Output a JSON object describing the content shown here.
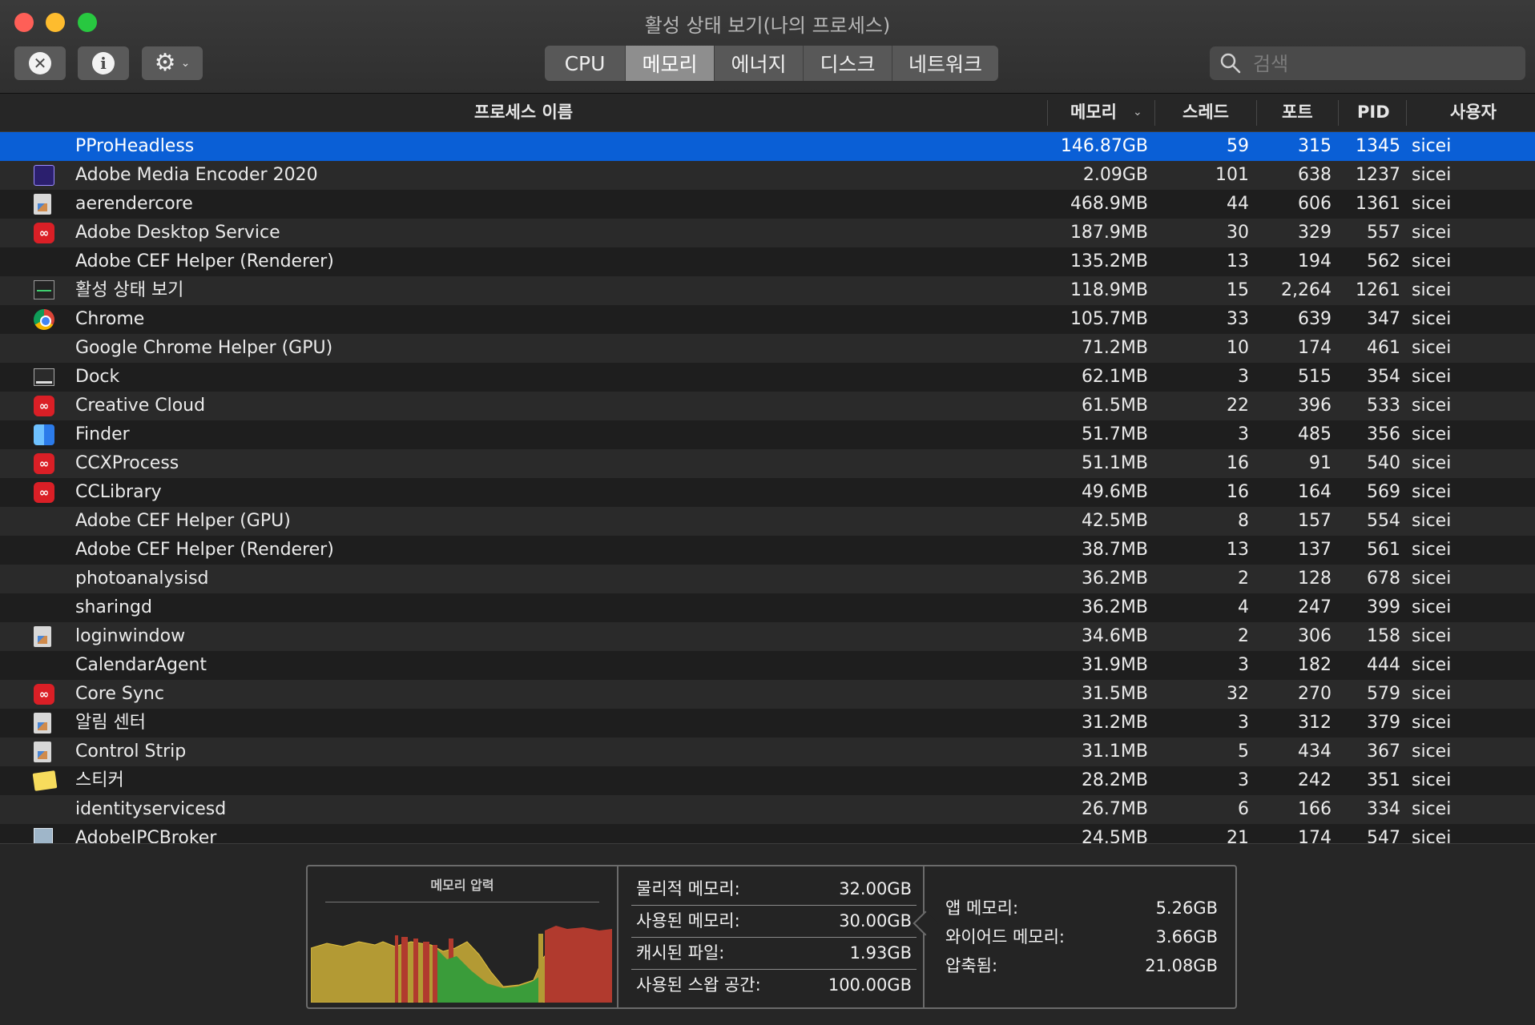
{
  "window": {
    "title": "활성 상태 보기(나의 프로세스)"
  },
  "toolbar": {
    "stop_icon": "x-circle-icon",
    "info_icon": "info-circle-icon",
    "gear_icon": "gear-icon",
    "tabs": [
      "CPU",
      "메모리",
      "에너지",
      "디스크",
      "네트워크"
    ],
    "active_tab": "메모리",
    "search": {
      "placeholder": "검색",
      "value": ""
    }
  },
  "table": {
    "columns": {
      "name": "프로세스 이름",
      "memory": "메모리",
      "threads": "스레드",
      "ports": "포트",
      "pid": "PID",
      "user": "사용자"
    },
    "sort_column": "memory",
    "sort_direction": "descending",
    "rows": [
      {
        "name": "PProHeadless",
        "memory": "146.87GB",
        "threads": "59",
        "ports": "315",
        "pid": "1345",
        "user": "sicei",
        "icon": "none",
        "selected": true
      },
      {
        "name": "Adobe Media Encoder 2020",
        "memory": "2.09GB",
        "threads": "101",
        "ports": "638",
        "pid": "1237",
        "user": "sicei",
        "icon": "media-encoder-icon"
      },
      {
        "name": "aerendercore",
        "memory": "468.9MB",
        "threads": "44",
        "ports": "606",
        "pid": "1361",
        "user": "sicei",
        "icon": "generic-app-icon"
      },
      {
        "name": "Adobe Desktop Service",
        "memory": "187.9MB",
        "threads": "30",
        "ports": "329",
        "pid": "557",
        "user": "sicei",
        "icon": "creative-cloud-icon"
      },
      {
        "name": "Adobe CEF Helper (Renderer)",
        "memory": "135.2MB",
        "threads": "13",
        "ports": "194",
        "pid": "562",
        "user": "sicei",
        "icon": "none"
      },
      {
        "name": "활성 상태 보기",
        "memory": "118.9MB",
        "threads": "15",
        "ports": "2,264",
        "pid": "1261",
        "user": "sicei",
        "icon": "activity-monitor-icon"
      },
      {
        "name": "Chrome",
        "memory": "105.7MB",
        "threads": "33",
        "ports": "639",
        "pid": "347",
        "user": "sicei",
        "icon": "chrome-icon"
      },
      {
        "name": "Google Chrome Helper (GPU)",
        "memory": "71.2MB",
        "threads": "10",
        "ports": "174",
        "pid": "461",
        "user": "sicei",
        "icon": "none"
      },
      {
        "name": "Dock",
        "memory": "62.1MB",
        "threads": "3",
        "ports": "515",
        "pid": "354",
        "user": "sicei",
        "icon": "dock-icon"
      },
      {
        "name": "Creative Cloud",
        "memory": "61.5MB",
        "threads": "22",
        "ports": "396",
        "pid": "533",
        "user": "sicei",
        "icon": "creative-cloud-icon"
      },
      {
        "name": "Finder",
        "memory": "51.7MB",
        "threads": "3",
        "ports": "485",
        "pid": "356",
        "user": "sicei",
        "icon": "finder-icon"
      },
      {
        "name": "CCXProcess",
        "memory": "51.1MB",
        "threads": "16",
        "ports": "91",
        "pid": "540",
        "user": "sicei",
        "icon": "creative-cloud-icon"
      },
      {
        "name": "CCLibrary",
        "memory": "49.6MB",
        "threads": "16",
        "ports": "164",
        "pid": "569",
        "user": "sicei",
        "icon": "creative-cloud-icon"
      },
      {
        "name": "Adobe CEF Helper (GPU)",
        "memory": "42.5MB",
        "threads": "8",
        "ports": "157",
        "pid": "554",
        "user": "sicei",
        "icon": "none"
      },
      {
        "name": "Adobe CEF Helper (Renderer)",
        "memory": "38.7MB",
        "threads": "13",
        "ports": "137",
        "pid": "561",
        "user": "sicei",
        "icon": "none"
      },
      {
        "name": "photoanalysisd",
        "memory": "36.2MB",
        "threads": "2",
        "ports": "128",
        "pid": "678",
        "user": "sicei",
        "icon": "none"
      },
      {
        "name": "sharingd",
        "memory": "36.2MB",
        "threads": "4",
        "ports": "247",
        "pid": "399",
        "user": "sicei",
        "icon": "none"
      },
      {
        "name": "loginwindow",
        "memory": "34.6MB",
        "threads": "2",
        "ports": "306",
        "pid": "158",
        "user": "sicei",
        "icon": "generic-app-icon"
      },
      {
        "name": "CalendarAgent",
        "memory": "31.9MB",
        "threads": "3",
        "ports": "182",
        "pid": "444",
        "user": "sicei",
        "icon": "none"
      },
      {
        "name": "Core Sync",
        "memory": "31.5MB",
        "threads": "32",
        "ports": "270",
        "pid": "579",
        "user": "sicei",
        "icon": "creative-cloud-icon"
      },
      {
        "name": "알림 센터",
        "memory": "31.2MB",
        "threads": "3",
        "ports": "312",
        "pid": "379",
        "user": "sicei",
        "icon": "generic-app-icon"
      },
      {
        "name": "Control Strip",
        "memory": "31.1MB",
        "threads": "5",
        "ports": "434",
        "pid": "367",
        "user": "sicei",
        "icon": "generic-app-icon"
      },
      {
        "name": "스티커",
        "memory": "28.2MB",
        "threads": "3",
        "ports": "242",
        "pid": "351",
        "user": "sicei",
        "icon": "stickies-icon"
      },
      {
        "name": "identityservicesd",
        "memory": "26.7MB",
        "threads": "6",
        "ports": "166",
        "pid": "334",
        "user": "sicei",
        "icon": "none"
      },
      {
        "name": "AdobeIPCBroker",
        "memory": "24.5MB",
        "threads": "21",
        "ports": "174",
        "pid": "547",
        "user": "sicei",
        "icon": "ipc-broker-icon"
      }
    ]
  },
  "memory_pressure": {
    "title": "메모리 압력"
  },
  "memory_stats": [
    {
      "label": "물리적 메모리:",
      "value": "32.00GB"
    },
    {
      "label": "사용된 메모리:",
      "value": "30.00GB"
    },
    {
      "label": "캐시된 파일:",
      "value": "1.93GB"
    },
    {
      "label": "사용된 스왑 공간:",
      "value": "100.00GB"
    }
  ],
  "app_stats": [
    {
      "label": "앱 메모리:",
      "value": "5.26GB"
    },
    {
      "label": "와이어드 메모리:",
      "value": "3.66GB"
    },
    {
      "label": "압축됨:",
      "value": "21.08GB"
    }
  ],
  "colors": {
    "selection": "#0a5fd6",
    "pressure_yellow": "#b89b2e",
    "pressure_red": "#c0392b",
    "pressure_green": "#3fae3f"
  }
}
